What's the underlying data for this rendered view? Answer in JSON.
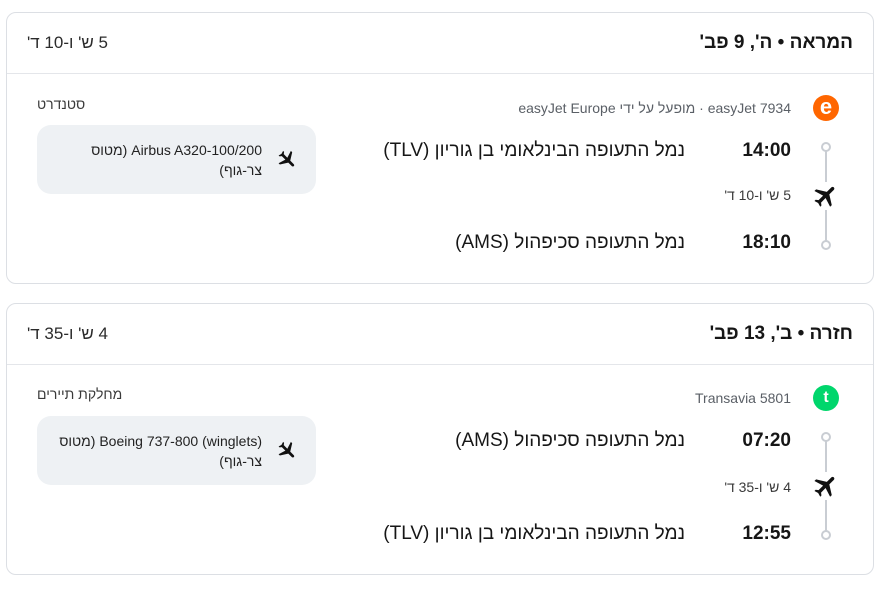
{
  "outbound": {
    "title": "המראה • ה', 9 פב'",
    "duration": "5 ש' ו-10 ד'",
    "logo_letter": "e",
    "carrier": "easyJet 7934 · מופעל על ידי easyJet Europe",
    "cabin": "סטנדרט",
    "departure": {
      "time": "14:00",
      "airport": "נמל התעופה הבינלאומי בן גוריון (TLV)"
    },
    "segment_duration": "5 ש' ו-10 ד'",
    "arrival": {
      "time": "18:10",
      "airport": "נמל התעופה סכיפהול (AMS)"
    },
    "aircraft": "Airbus A320-100/200 (מטוס צר-גוף)"
  },
  "return": {
    "title": "חזרה • ב', 13 פב'",
    "duration": "4 ש' ו-35 ד'",
    "logo_letter": "t",
    "carrier": "Transavia 5801",
    "cabin": "מחלקת תיירים",
    "departure": {
      "time": "07:20",
      "airport": "נמל התעופה סכיפהול (AMS)"
    },
    "segment_duration": "4 ש' ו-35 ד'",
    "arrival": {
      "time": "12:55",
      "airport": "נמל התעופה הבינלאומי בן גוריון (TLV)"
    },
    "aircraft": "Boeing 737-800 (winglets) (מטוס צר-גוף)"
  },
  "colors": {
    "easyjet": "#ff6600",
    "transavia": "#00d66c",
    "muted_box": "#eef1f4",
    "timeline": "#c9cdd3"
  },
  "icons": {
    "timeline": "airplane-icon",
    "aircraft": "airplane-icon"
  }
}
